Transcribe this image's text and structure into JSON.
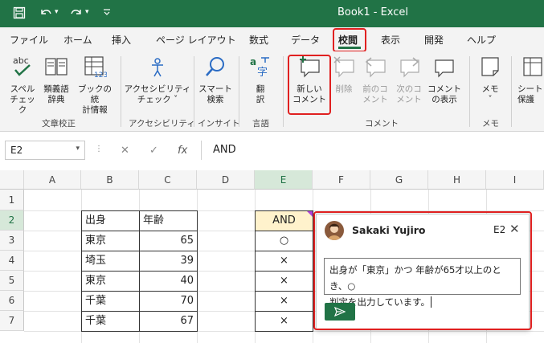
{
  "titlebar": {
    "title": "Book1  -  Excel",
    "save_icon": "save-icon",
    "undo_icon": "undo-icon",
    "redo_icon": "redo-icon"
  },
  "tabs": [
    {
      "label": "ファイル"
    },
    {
      "label": "ホーム"
    },
    {
      "label": "挿入"
    },
    {
      "label": "ページ レイアウト"
    },
    {
      "label": "数式"
    },
    {
      "label": "データ"
    },
    {
      "label": "校閲",
      "active": true
    },
    {
      "label": "表示"
    },
    {
      "label": "開発"
    },
    {
      "label": "ヘルプ"
    }
  ],
  "ribbon": {
    "spell_1": "スペル",
    "spell_2": "チェック",
    "thes_1": "類義語",
    "thes_2": "辞典",
    "stats_1": "ブックの統",
    "stats_2": "計情報",
    "grp_proof": "文章校正",
    "access_1": "アクセシビリティ",
    "access_2": "チェック ˇ",
    "grp_access": "アクセシビリティ",
    "smart_1": "スマート",
    "smart_2": "検索",
    "grp_insight": "インサイト",
    "trans_1": "翻",
    "trans_2": "訳",
    "grp_lang": "言語",
    "new_1": "新しい",
    "new_2": "コメント",
    "del": "削除",
    "prev_1": "前のコ",
    "prev_2": "メント",
    "next_1": "次のコ",
    "next_2": "メント",
    "show_1": "コメント",
    "show_2": "の表示",
    "grp_comment": "コメント",
    "memo_1": "メモ",
    "memo_2": "ˇ",
    "grp_memo": "メモ",
    "sheet_1": "シート",
    "sheet_2": "保護",
    "abc": "abc"
  },
  "formula_bar": {
    "name_box": "E2",
    "cancel": "✕",
    "enter": "✓",
    "fx": "fx",
    "formula": "AND"
  },
  "columns": [
    "A",
    "B",
    "C",
    "D",
    "E",
    "F",
    "G",
    "H",
    "I"
  ],
  "rows": [
    "1",
    "2",
    "3",
    "4",
    "5",
    "6",
    "7"
  ],
  "table": {
    "header_origin": "出身",
    "header_age": "年齢",
    "rows": [
      {
        "origin": "東京",
        "age": "65"
      },
      {
        "origin": "埼玉",
        "age": "39"
      },
      {
        "origin": "東京",
        "age": "40"
      },
      {
        "origin": "千葉",
        "age": "70"
      },
      {
        "origin": "千葉",
        "age": "67"
      }
    ]
  },
  "judge": {
    "header": "AND",
    "values": [
      "○",
      "×",
      "×",
      "×",
      "×"
    ]
  },
  "comment": {
    "author": "Sakaki Yujiro",
    "cell_ref": "E2",
    "line1": "出身が「東京」かつ 年齢が65才以上のとき、○",
    "line2": "判定を出力しています。",
    "send_icon": "send-icon",
    "close": "✕"
  },
  "colors": {
    "accent": "#217346",
    "highlight_box": "#e02020",
    "selected_cell_fill": "#fff2cc"
  }
}
